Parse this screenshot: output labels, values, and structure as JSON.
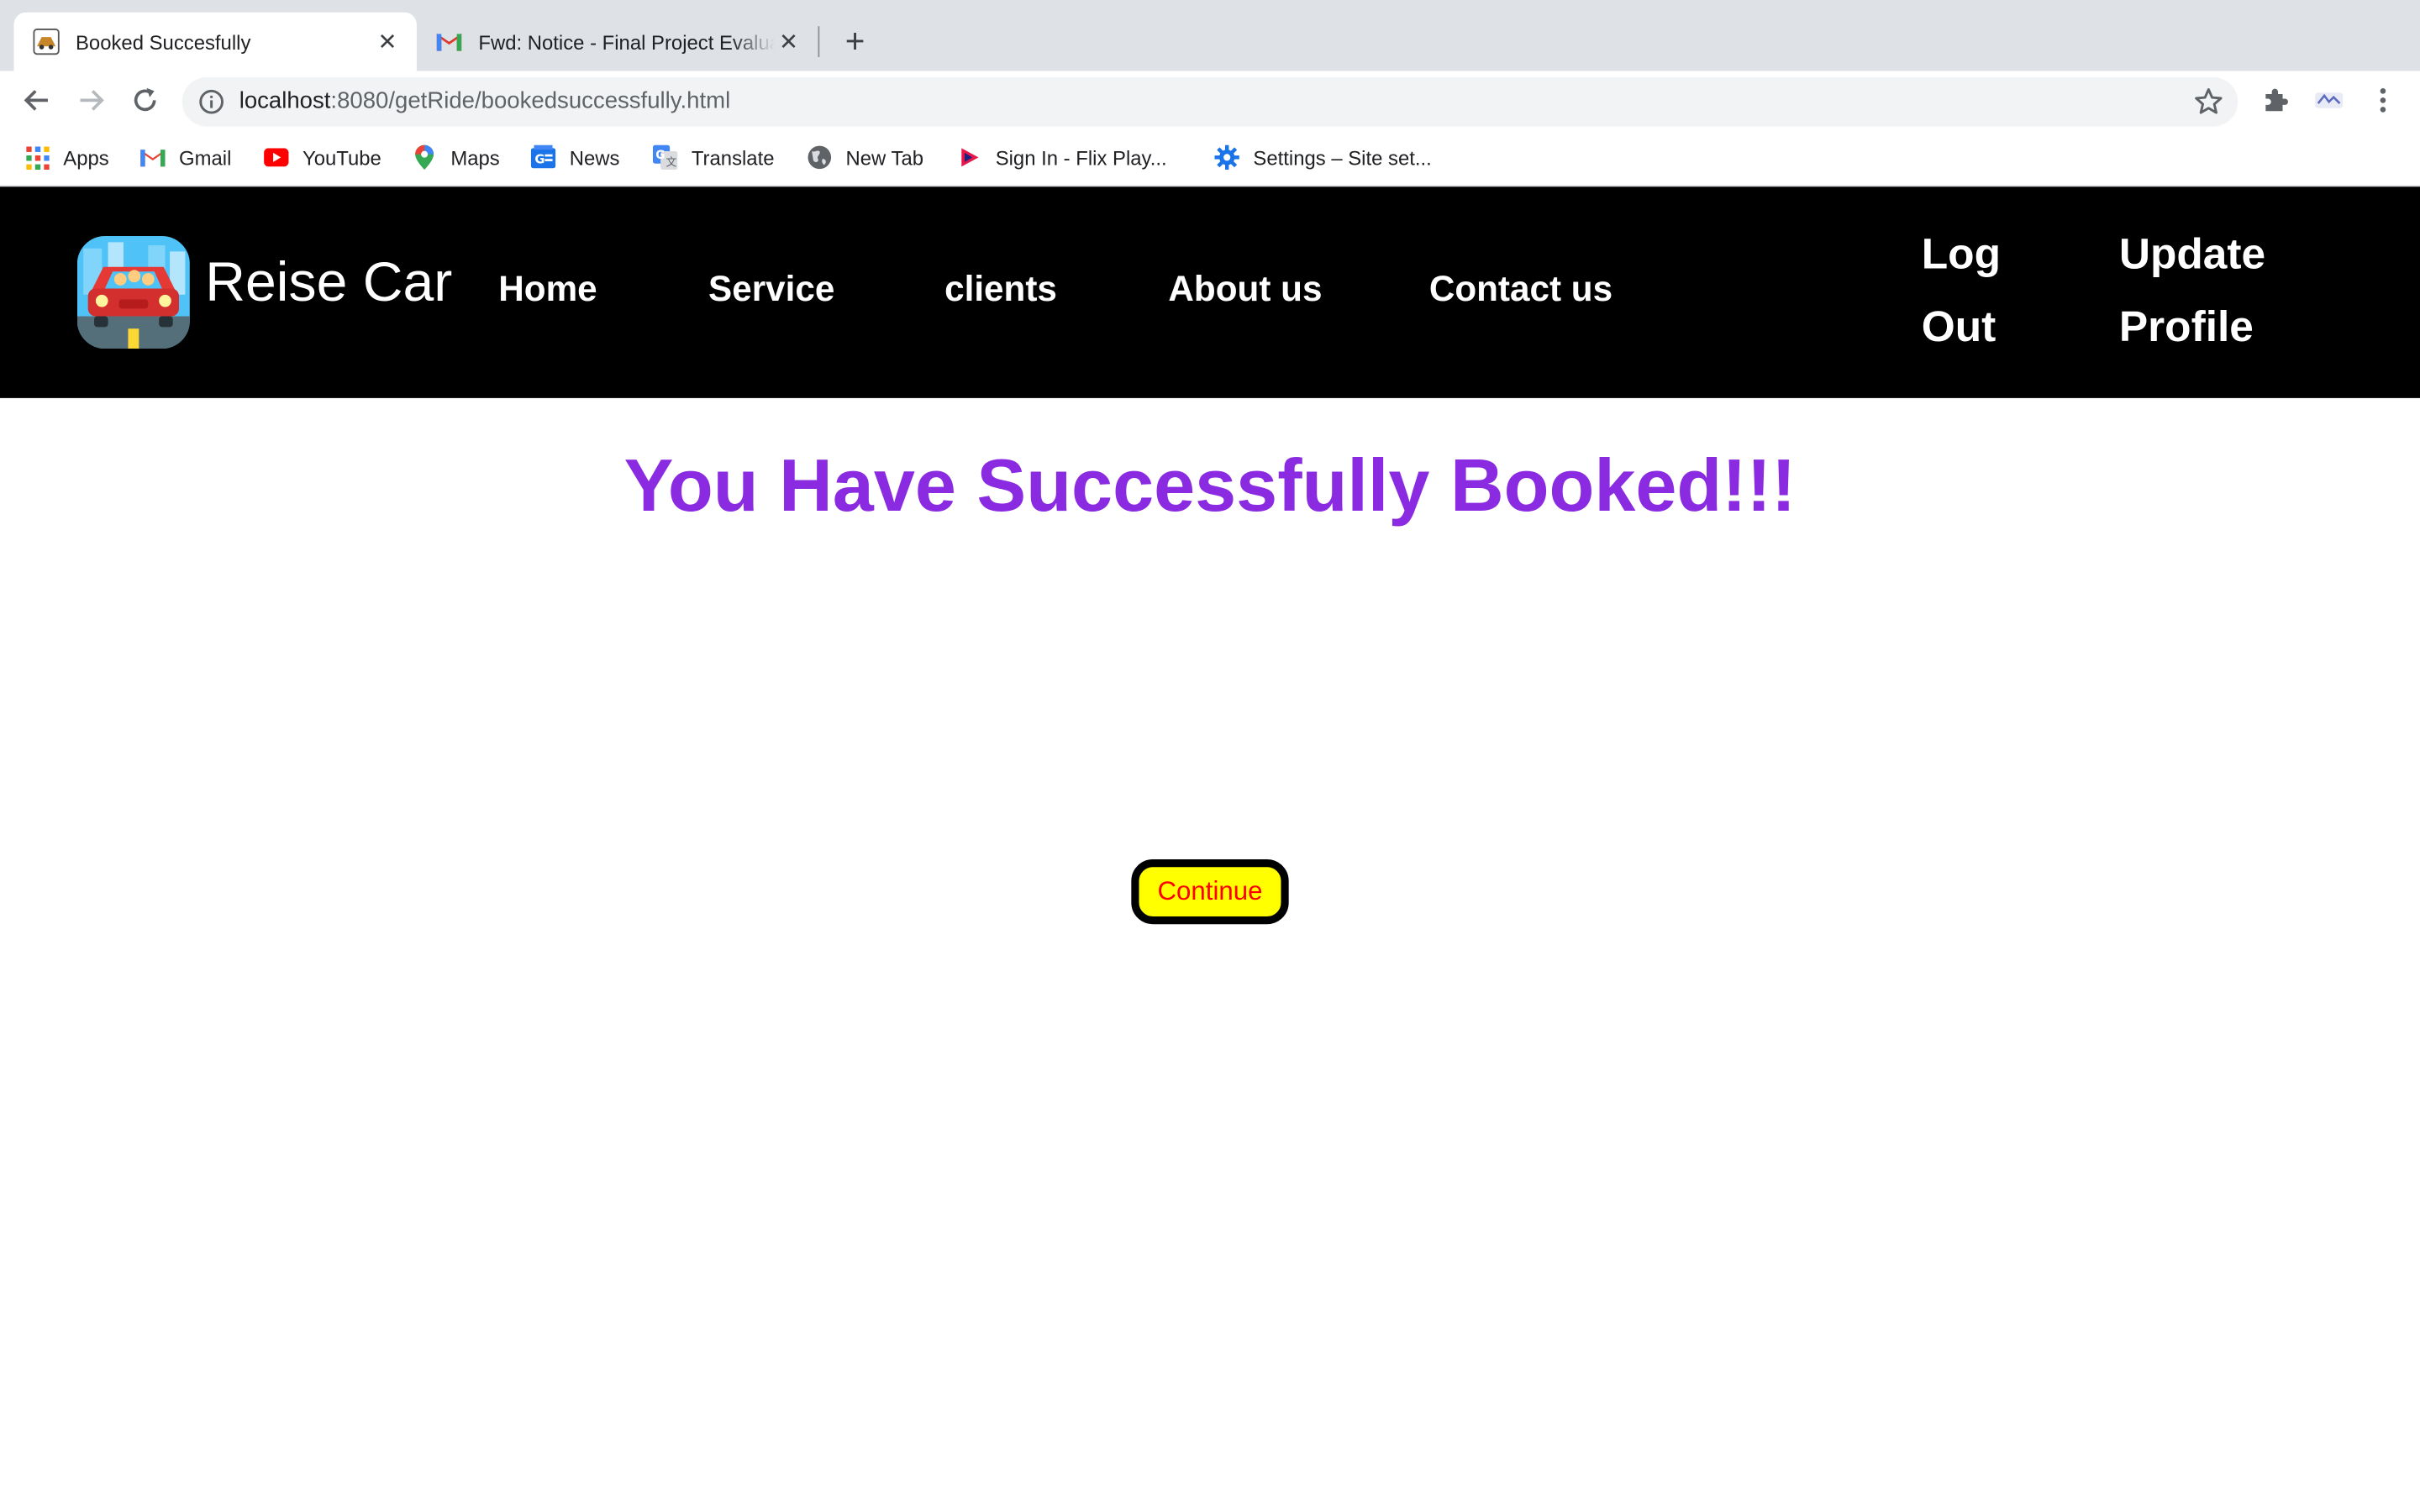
{
  "browser": {
    "tabs": [
      {
        "title": "Booked Succesfully",
        "active": true
      },
      {
        "title": "Fwd: Notice - Final Project Evaluation",
        "active": false
      }
    ],
    "address": {
      "host": "localhost",
      "path": ":8080/getRide/bookedsuccessfully.html"
    },
    "bookmarks": [
      {
        "label": "Apps",
        "icon": "apps-grid-icon"
      },
      {
        "label": "Gmail",
        "icon": "gmail-icon"
      },
      {
        "label": "YouTube",
        "icon": "youtube-icon"
      },
      {
        "label": "Maps",
        "icon": "maps-pin-icon"
      },
      {
        "label": "News",
        "icon": "google-news-icon"
      },
      {
        "label": "Translate",
        "icon": "google-translate-icon"
      },
      {
        "label": "New Tab",
        "icon": "globe-icon"
      },
      {
        "label": "Sign In - Flix Play...",
        "icon": "flix-play-icon"
      },
      {
        "label": "Settings – Site set...",
        "icon": "gear-icon"
      }
    ]
  },
  "site": {
    "brand": "Reise Car",
    "nav": [
      "Home",
      "Service",
      "clients",
      "About us",
      "Contact us"
    ],
    "logout": {
      "line1": "Log",
      "line2": "Out"
    },
    "update_profile": {
      "line1": "Update",
      "line2": "Profile"
    }
  },
  "main": {
    "headline": "You Have Successfully Booked!!!",
    "continue_label": "Continue"
  },
  "colors": {
    "header_bg": "#000000",
    "headline": "#8a2be2",
    "button_bg": "#ffff00",
    "button_text": "#ff0000",
    "button_border": "#000000"
  }
}
